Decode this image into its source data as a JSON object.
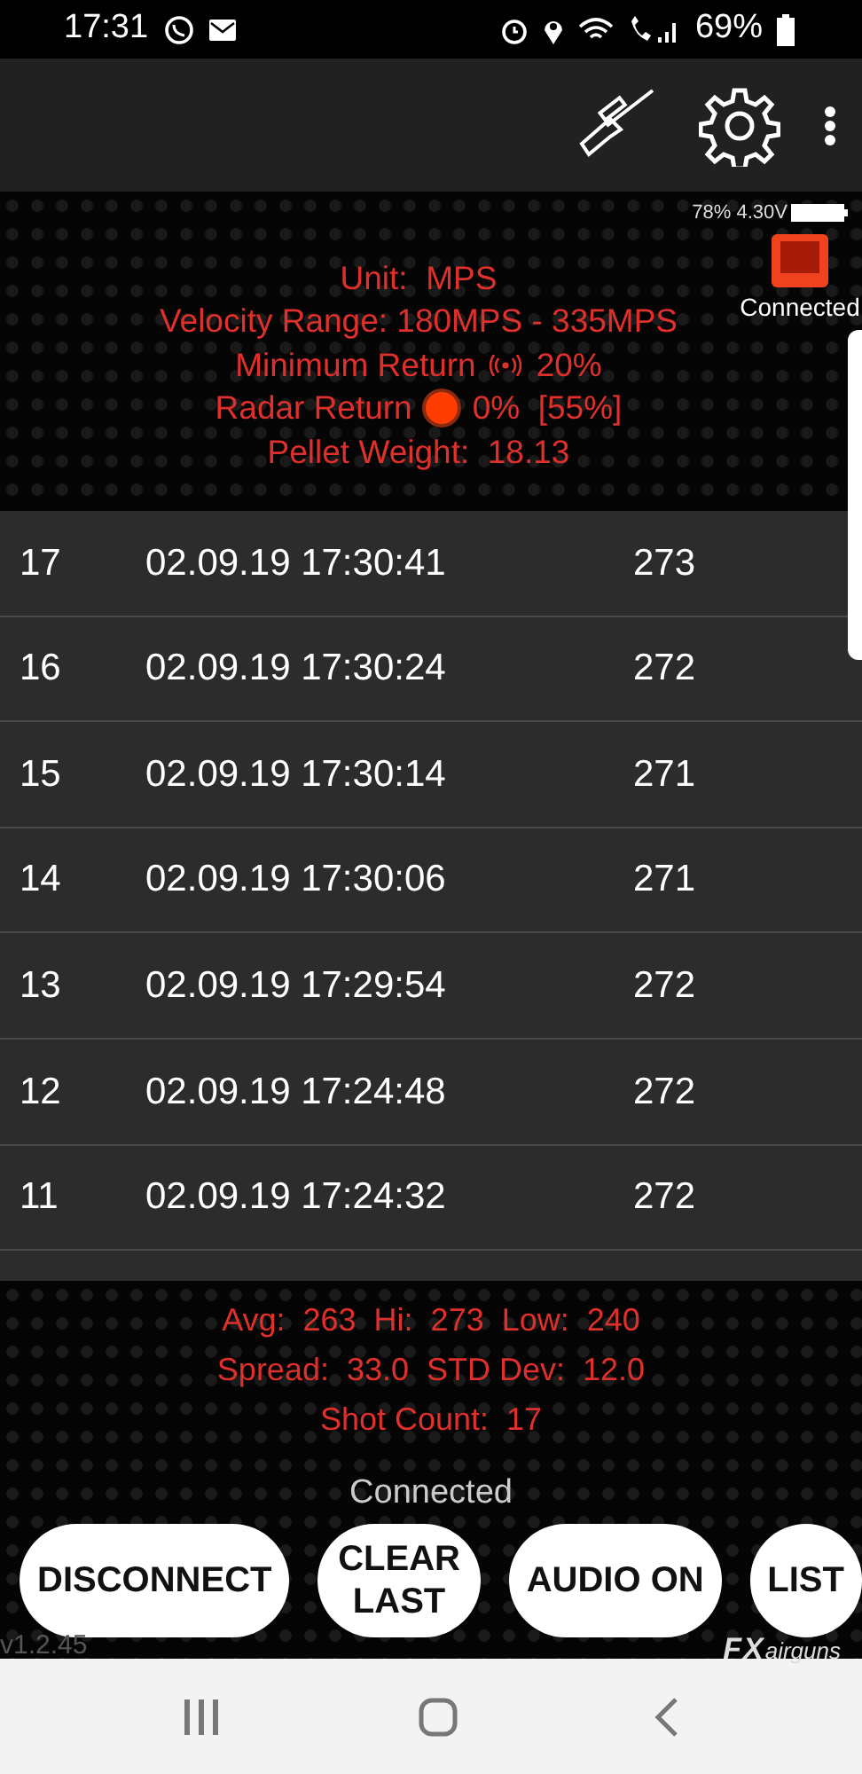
{
  "status_bar": {
    "time": "17:31",
    "battery": "69%"
  },
  "device": {
    "battery": "78% 4.30V",
    "status": "Connected"
  },
  "info": [
    {
      "kind": "text",
      "text": "Unit:  MPS"
    },
    {
      "kind": "text",
      "text": "Velocity Range: 180MPS - 335MPS"
    },
    {
      "kind": "signal",
      "label": "Minimum Return",
      "value": "20%"
    },
    {
      "kind": "dot",
      "label": "Radar Return",
      "value": "0%  [55%]",
      "color": "#ff3d00"
    },
    {
      "kind": "text",
      "text": "Pellet Weight:  18.13"
    }
  ],
  "shots": [
    {
      "number": "17",
      "time": "02.09.19 17:30:41",
      "velocity": "273"
    },
    {
      "number": "16",
      "time": "02.09.19 17:30:24",
      "velocity": "272"
    },
    {
      "number": "15",
      "time": "02.09.19 17:30:14",
      "velocity": "271"
    },
    {
      "number": "14",
      "time": "02.09.19 17:30:06",
      "velocity": "271"
    },
    {
      "number": "13",
      "time": "02.09.19 17:29:54",
      "velocity": "272"
    },
    {
      "number": "12",
      "time": "02.09.19 17:24:48",
      "velocity": "272"
    },
    {
      "number": "11",
      "time": "02.09.19 17:24:32",
      "velocity": "272"
    }
  ],
  "stats": [
    "Avg:  263  Hi:  273  Low:  240",
    "Spread:  33.0  STD Dev:  12.0",
    "Shot Count:  17"
  ],
  "connection_status": "Connected",
  "buttons": [
    "DISCONNECT",
    "CLEAR LAST",
    "AUDIO ON",
    "LIST"
  ],
  "version": "v1.2.45",
  "logo": {
    "mark": "FX",
    "word": "airguns"
  }
}
